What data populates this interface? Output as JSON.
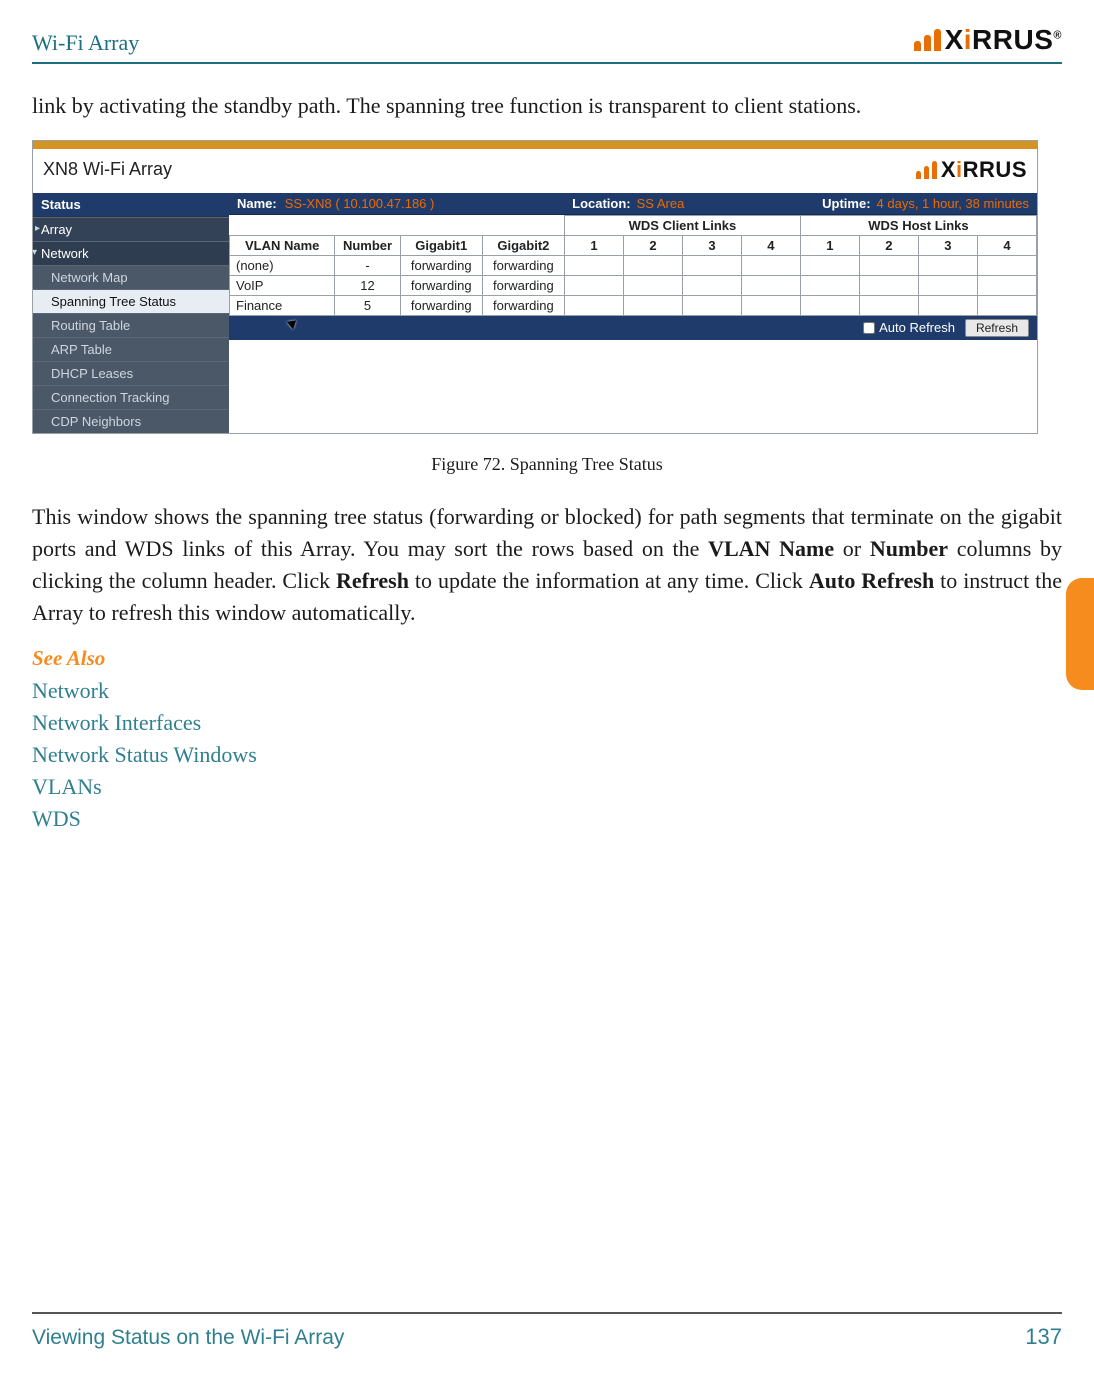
{
  "header": {
    "title": "Wi-Fi Array",
    "brand": "XIRRUS"
  },
  "intro_para": "link by activating the standby path. The spanning tree function is transparent to client stations.",
  "figure": {
    "product_title": "XN8 Wi-Fi Array",
    "brand": "XIRRUS",
    "nav": {
      "section": "Status",
      "items": [
        {
          "label": "Array",
          "cls": "top"
        },
        {
          "label": "Network",
          "cls": "open"
        },
        {
          "label": "Network Map",
          "cls": ""
        },
        {
          "label": "Spanning Tree Status",
          "cls": "active"
        },
        {
          "label": "Routing Table",
          "cls": ""
        },
        {
          "label": "ARP Table",
          "cls": ""
        },
        {
          "label": "DHCP Leases",
          "cls": ""
        },
        {
          "label": "Connection Tracking",
          "cls": ""
        },
        {
          "label": "CDP Neighbors",
          "cls": ""
        }
      ]
    },
    "meta": {
      "name_label": "Name:",
      "name_value": "SS-XN8   ( 10.100.47.186 )",
      "loc_label": "Location:",
      "loc_value": "SS Area",
      "up_label": "Uptime:",
      "up_value": "4 days, 1 hour, 38 minutes"
    },
    "table": {
      "group_client": "WDS Client Links",
      "group_host": "WDS Host Links",
      "cols": [
        "VLAN Name",
        "Number",
        "Gigabit1",
        "Gigabit2",
        "1",
        "2",
        "3",
        "4",
        "1",
        "2",
        "3",
        "4"
      ],
      "rows": [
        [
          "(none)",
          "-",
          "forwarding",
          "forwarding",
          "",
          "",
          "",
          "",
          "",
          "",
          "",
          ""
        ],
        [
          "VoIP",
          "12",
          "forwarding",
          "forwarding",
          "",
          "",
          "",
          "",
          "",
          "",
          "",
          ""
        ],
        [
          "Finance",
          "5",
          "forwarding",
          "forwarding",
          "",
          "",
          "",
          "",
          "",
          "",
          "",
          ""
        ]
      ]
    },
    "footerbar": {
      "auto": "Auto Refresh",
      "refresh": "Refresh"
    },
    "caption": "Figure 72. Spanning Tree Status"
  },
  "expl_para": {
    "t1": "This window shows the spanning tree status (forwarding or blocked) for path segments that terminate on the gigabit ports and WDS links of this Array. You may sort the rows based on the ",
    "b1": "VLAN Name",
    "t2": " or ",
    "b2": "Number",
    "t3": " columns by clicking the column header. Click ",
    "b3": "Refresh",
    "t4": " to update the information at any time. Click ",
    "b4": "Auto Refresh",
    "t5": " to instruct the Array to refresh this window automatically."
  },
  "see_also": {
    "heading": "See Also",
    "links": [
      "Network",
      "Network Interfaces",
      "Network Status Windows",
      "VLANs",
      "WDS"
    ]
  },
  "footer": {
    "section": "Viewing Status on the Wi-Fi Array",
    "page": "137"
  }
}
